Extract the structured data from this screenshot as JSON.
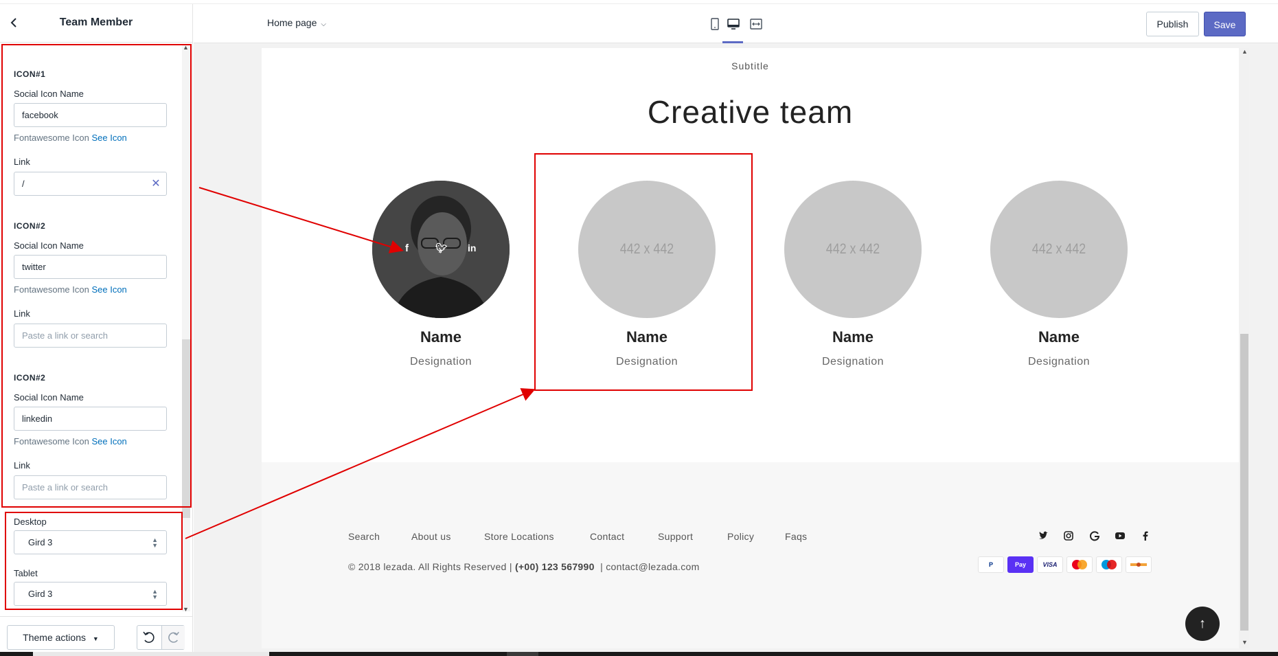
{
  "sidebar": {
    "title": "Team Member",
    "icons": [
      {
        "heading": "ICON#1",
        "name_label": "Social Icon Name",
        "name_value": "facebook",
        "help_prefix": "Fontawesome Icon",
        "help_link": "See Icon",
        "link_label": "Link",
        "link_value": "/",
        "link_placeholder": ""
      },
      {
        "heading": "ICON#2",
        "name_label": "Social Icon Name",
        "name_value": "twitter",
        "help_prefix": "Fontawesome Icon",
        "help_link": "See Icon",
        "link_label": "Link",
        "link_value": "",
        "link_placeholder": "Paste a link or search"
      },
      {
        "heading": "ICON#2",
        "name_label": "Social Icon Name",
        "name_value": "linkedin",
        "help_prefix": "Fontawesome Icon",
        "help_link": "See Icon",
        "link_label": "Link",
        "link_value": "",
        "link_placeholder": "Paste a link or search"
      }
    ],
    "desktop_label": "Desktop",
    "desktop_value": "Gird 3",
    "tablet_label": "Tablet",
    "tablet_value": "Gird 3",
    "theme_actions": "Theme actions"
  },
  "topbar": {
    "page_select": "Home page",
    "publish": "Publish",
    "save": "Save",
    "devices": [
      "mobile-icon",
      "desktop-icon",
      "fullwidth-icon"
    ],
    "active_device": "desktop-icon"
  },
  "preview": {
    "subtitle": "Subtitle",
    "title": "Creative team",
    "members": [
      {
        "name": "Name",
        "designation": "Designation",
        "image": "photo",
        "social": [
          "facebook-icon",
          "twitter-icon",
          "linkedin-icon"
        ]
      },
      {
        "name": "Name",
        "designation": "Designation",
        "image": "442 x 442"
      },
      {
        "name": "Name",
        "designation": "Designation",
        "image": "442 x 442"
      },
      {
        "name": "Name",
        "designation": "Designation",
        "image": "442 x 442"
      }
    ],
    "footer": {
      "links": [
        "Search",
        "About us",
        "Store Locations",
        "Contact",
        "Support",
        "Policy",
        "Faqs"
      ],
      "copyright_prefix": "© 2018 lezada. All Rights Reserved |",
      "phone": "(+00) 123 567990",
      "email_part": "| contact@lezada.com",
      "social": [
        "twitter-icon",
        "instagram-icon",
        "google-icon",
        "youtube-icon",
        "facebook-icon"
      ],
      "payments": [
        "P",
        "Pay",
        "VISA",
        "",
        "",
        ""
      ]
    }
  },
  "colors": {
    "accent": "#5c6ac4",
    "annotation": "#e00000",
    "link": "#006fbb"
  }
}
